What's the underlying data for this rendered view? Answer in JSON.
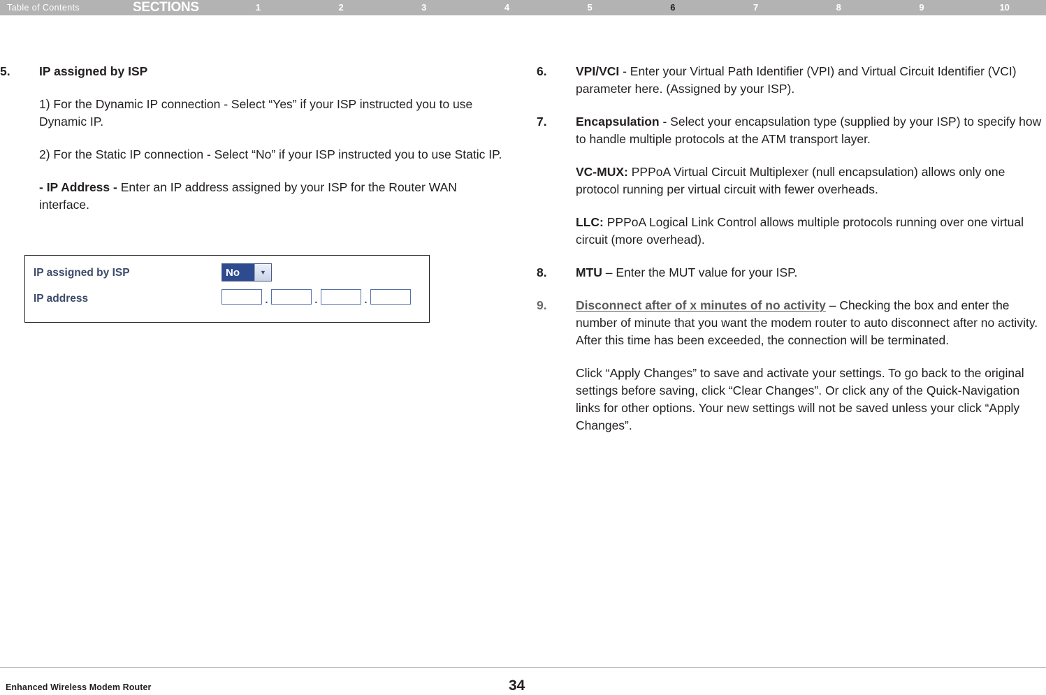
{
  "topbar": {
    "toc_label": "Table of Contents",
    "sections_label": "SECTIONS",
    "section_numbers": [
      "1",
      "2",
      "3",
      "4",
      "5",
      "6",
      "7",
      "8",
      "9",
      "10"
    ],
    "active_section": "6"
  },
  "left_column": {
    "item5": {
      "number": "5.",
      "heading": "IP assigned by ISP",
      "para1": "1) For the Dynamic IP connection - Select “Yes” if your ISP instructed you to use Dynamic IP.",
      "para2": "2) For the Static IP connection - Select “No” if your ISP instructed you to use Static IP.",
      "para3_bold": "- IP Address - ",
      "para3_rest": "Enter an IP address assigned by your ISP for the Router WAN interface."
    }
  },
  "figure": {
    "row1_label": "IP assigned by ISP",
    "row1_select_value": "No",
    "row1_select_arrow": "▼",
    "row2_label": "IP address",
    "ip_separator": ".",
    "ip_octets": [
      "",
      "",
      "",
      ""
    ]
  },
  "right_column": {
    "item6": {
      "number": "6.",
      "bold": "VPI/VCI",
      "text": " - Enter your Virtual Path Identifier (VPI) and Virtual Circuit Identifier (VCI) parameter here. (Assigned by your ISP)."
    },
    "item7": {
      "number": "7.",
      "bold": "Encapsulation",
      "text": " - Select your encapsulation type (supplied by your ISP) to specify how to handle multiple protocols at the ATM transport layer.",
      "vcmux_bold": "VC-MUX: ",
      "vcmux_text": "PPPoA Virtual Circuit Multiplexer (null encapsulation) allows only one protocol running per virtual circuit with fewer overheads.",
      "llc_bold": "LLC: ",
      "llc_text": "PPPoA Logical Link Control allows multiple protocols running over one virtual circuit (more overhead)."
    },
    "item8": {
      "number": "8.",
      "bold": "MTU",
      "text": " – Enter the MUT value for your ISP."
    },
    "item9": {
      "number": "9.",
      "bold": "Disconnect after of x minutes of no activity",
      "text": " – Checking the box and enter the number of minute that you want the modem router to auto disconnect after no activity. After this time has been exceeded, the connection will be terminated.",
      "para2": "Click “Apply Changes” to save and activate your settings. To go back to the original settings before saving, click “Clear Changes”. Or click any of the Quick-Navigation links for other options. Your new settings will not be saved unless your click “Apply Changes”."
    }
  },
  "footer": {
    "product": "Enhanced Wireless Modem Router",
    "page_number": "34"
  }
}
